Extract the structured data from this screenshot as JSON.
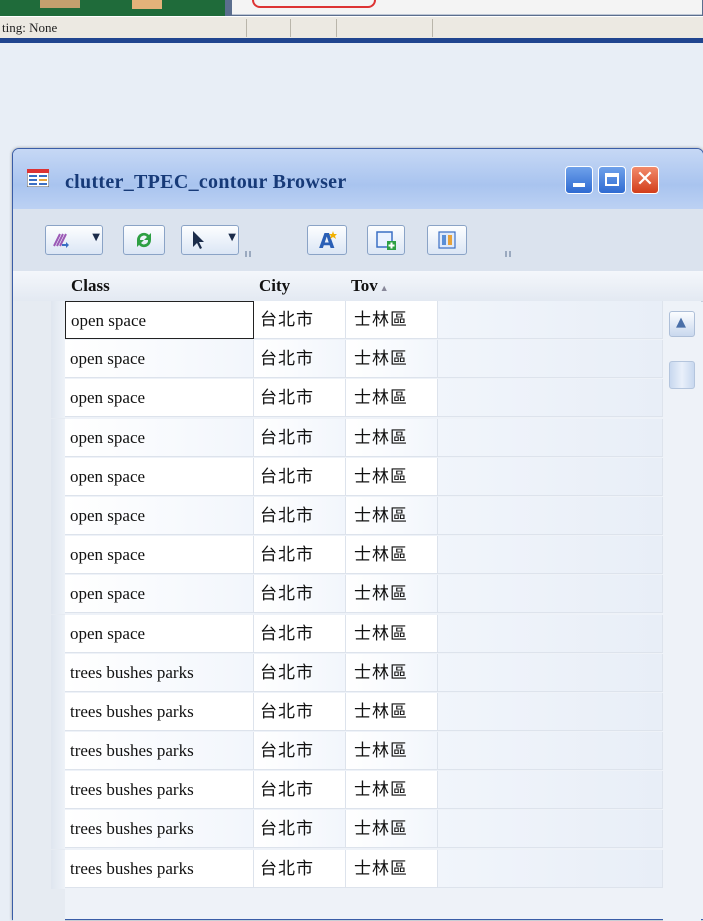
{
  "status_bar": {
    "text": "ting: None"
  },
  "window": {
    "title": "clutter_TPEC_contour Browser",
    "close_glyph": "✕"
  },
  "toolbar": {
    "buttons": [
      {
        "icon": "pick-fields-icon"
      },
      {
        "icon": "refresh-icon"
      },
      {
        "icon": "select-pointer-icon"
      },
      {
        "icon": "label-icon"
      },
      {
        "icon": "new-record-icon"
      },
      {
        "icon": "columns-icon"
      }
    ]
  },
  "grid": {
    "columns": [
      "Class",
      "City",
      "Tov"
    ],
    "sort_indicator": "▲",
    "rows": [
      {
        "class": "open space",
        "city": "台北市",
        "town": "士林區"
      },
      {
        "class": "open space",
        "city": "台北市",
        "town": "士林區"
      },
      {
        "class": "open space",
        "city": "台北市",
        "town": "士林區"
      },
      {
        "class": "open space",
        "city": "台北市",
        "town": "士林區"
      },
      {
        "class": "open space",
        "city": "台北市",
        "town": "士林區"
      },
      {
        "class": "open space",
        "city": "台北市",
        "town": "士林區"
      },
      {
        "class": "open space",
        "city": "台北市",
        "town": "士林區"
      },
      {
        "class": "open space",
        "city": "台北市",
        "town": "士林區"
      },
      {
        "class": "open space",
        "city": "台北市",
        "town": "士林區"
      },
      {
        "class": "trees bushes parks",
        "city": "台北市",
        "town": "士林區"
      },
      {
        "class": "trees bushes parks",
        "city": "台北市",
        "town": "士林區"
      },
      {
        "class": "trees bushes parks",
        "city": "台北市",
        "town": "士林區"
      },
      {
        "class": "trees bushes parks",
        "city": "台北市",
        "town": "士林區"
      },
      {
        "class": "trees bushes parks",
        "city": "台北市",
        "town": "士林區"
      },
      {
        "class": "trees bushes parks",
        "city": "台北市",
        "town": "士林區"
      }
    ]
  }
}
